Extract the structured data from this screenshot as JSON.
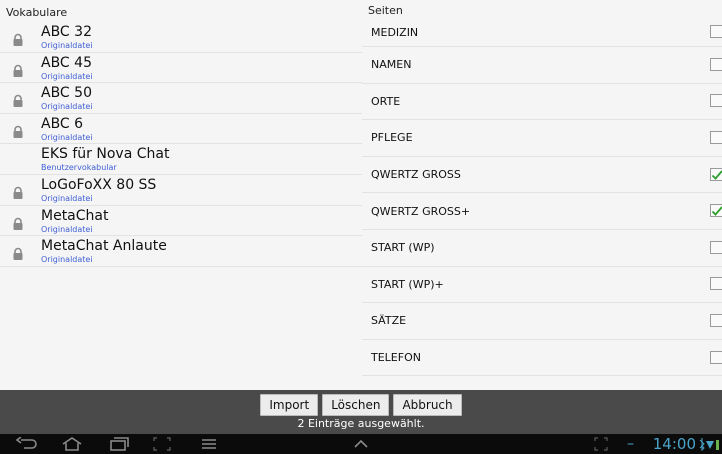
{
  "left_header": "Vokabulare",
  "right_header": "Seiten",
  "vocabularies": [
    {
      "name": "ABC 32",
      "type": "Originaldatei",
      "locked": true
    },
    {
      "name": "ABC 45",
      "type": "Originaldatei",
      "locked": true
    },
    {
      "name": "ABC 50",
      "type": "Originaldatei",
      "locked": true
    },
    {
      "name": "ABC 6",
      "type": "Originaldatei",
      "locked": true
    },
    {
      "name": "EKS für Nova Chat",
      "type": "Benutzervokabular",
      "locked": false
    },
    {
      "name": "LoGoFoXX 80 SS",
      "type": "Originaldatei",
      "locked": true
    },
    {
      "name": "MetaChat",
      "type": "Originaldatei",
      "locked": true
    },
    {
      "name": "MetaChat Anlaute",
      "type": "Originaldatei",
      "locked": true
    }
  ],
  "pages": [
    {
      "label": "MEDIZIN",
      "checked": false
    },
    {
      "label": "NAMEN",
      "checked": false
    },
    {
      "label": "ORTE",
      "checked": false
    },
    {
      "label": "PFLEGE",
      "checked": false
    },
    {
      "label": "QWERTZ GROSS",
      "checked": true
    },
    {
      "label": "QWERTZ GROSS+",
      "checked": true
    },
    {
      "label": "START (WP)",
      "checked": false
    },
    {
      "label": "START (WP)+",
      "checked": false
    },
    {
      "label": "SÄTZE",
      "checked": false
    },
    {
      "label": "TELEFON",
      "checked": false
    }
  ],
  "buttons": {
    "import_label": "Import",
    "delete_label": "Löschen",
    "cancel_label": "Abbruch"
  },
  "status": "2 Einträge ausgewählt.",
  "system_bar": {
    "time": "14:00",
    "accent_color": "#4aa3c9"
  },
  "colors": {
    "type_text": "#3f5fd6",
    "check_green": "#2e9e2e"
  }
}
